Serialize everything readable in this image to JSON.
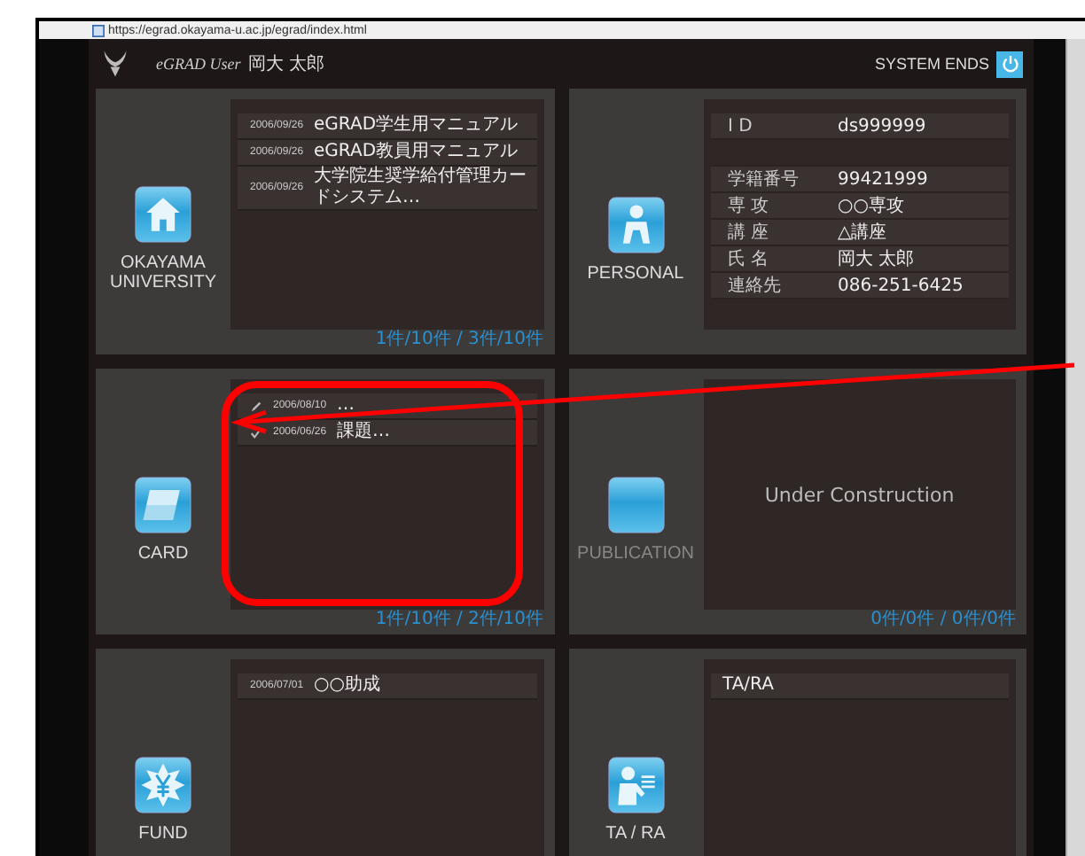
{
  "browser": {
    "url": "https://egrad.okayama-u.ac.jp/egrad/index.html"
  },
  "header": {
    "brand": "eGRAD User",
    "user": "岡大 太郎",
    "logout": "SYSTEM ENDS"
  },
  "panels": [
    {
      "kind": "news",
      "title": "OKAYAMA UNIVERSITY",
      "disabled": false,
      "items": [
        {
          "date": "2006/09/26",
          "text": "eGRAD学生用マニュアル",
          "kind": "plain"
        },
        {
          "date": "2006/09/26",
          "text": "eGRAD教員用マニュアル",
          "kind": "plain"
        },
        {
          "date": "2006/09/26",
          "text": "大学院生奨学給付管理カードシステム…",
          "kind": "plain"
        }
      ],
      "footer": "1件/10件 / 3件/10件"
    },
    {
      "kind": "profile",
      "title": "PERSONAL",
      "disabled": false,
      "rows": [
        {
          "label": "I D",
          "value": "ds999999"
        },
        {
          "label": "",
          "value": ""
        },
        {
          "label": "学籍番号",
          "value": "99421999"
        },
        {
          "label": "専 攻",
          "value": "○○専攻"
        },
        {
          "label": "講 座",
          "value": "△講座"
        },
        {
          "label": "氏 名",
          "value": "岡大 太郎"
        },
        {
          "label": "連絡先",
          "value": "086-251-6425"
        }
      ]
    },
    {
      "kind": "news",
      "title": "CARD",
      "disabled": false,
      "items": [
        {
          "date": "2006/08/10",
          "text": "…",
          "kind": "edit"
        },
        {
          "date": "2006/06/26",
          "text": "課題…",
          "kind": "confirmed"
        }
      ],
      "footer": "1件/10件 / 2件/10件"
    },
    {
      "kind": "message",
      "title": "PUBLICATION",
      "disabled": true,
      "message": "Under Construction",
      "footer": "0件/0件 / 0件/0件"
    },
    {
      "kind": "news",
      "title": "FUND",
      "disabled": false,
      "items": [
        {
          "date": "2006/07/01",
          "text": "○○助成",
          "kind": "plain"
        }
      ]
    },
    {
      "kind": "news",
      "title": "TA / RA",
      "disabled": false,
      "items": [
        {
          "text": "TA/RA",
          "kind": "plain"
        }
      ]
    }
  ]
}
